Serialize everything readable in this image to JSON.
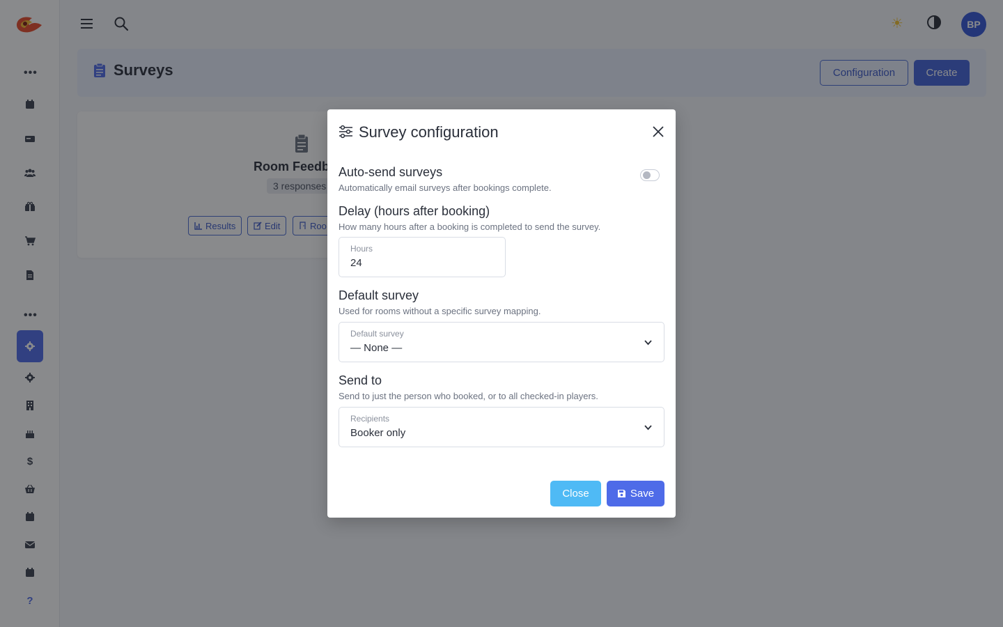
{
  "topbar": {
    "avatar_initials": "BP",
    "icons": [
      "menu-icon",
      "search-icon",
      "sun-icon",
      "contrast-icon"
    ]
  },
  "sidebar": {
    "active_color": "#4e6be8",
    "icons": [
      "dots-icon",
      "calendar-icon",
      "card-icon",
      "users-icon",
      "gift-icon",
      "cart-icon",
      "document-icon",
      "dots-icon",
      "gear-icon",
      "gear-icon",
      "building-icon",
      "cake-icon",
      "dollar-icon",
      "basket-icon",
      "calendar-icon",
      "mail-icon",
      "calendar-icon",
      "help-icon"
    ],
    "dollar_label": "$",
    "help_label": "?"
  },
  "page": {
    "title": "Surveys",
    "configuration_label": "Configuration",
    "create_label": "Create"
  },
  "survey_card": {
    "title": "Room Feedb",
    "responses": "3 responses",
    "results_label": "Results",
    "edit_label": "Edit",
    "rooms_label": "Roo"
  },
  "modal": {
    "title": "Survey configuration",
    "auto_send": {
      "title": "Auto-send surveys",
      "desc": "Automatically email surveys after bookings complete.",
      "enabled": false
    },
    "delay": {
      "title": "Delay (hours after booking)",
      "desc": "How many hours after a booking is completed to send the survey.",
      "label": "Hours",
      "value": "24"
    },
    "default_survey": {
      "title": "Default survey",
      "desc": "Used for rooms without a specific survey mapping.",
      "label": "Default survey",
      "value": "— None —"
    },
    "send_to": {
      "title": "Send to",
      "desc": "Send to just the person who booked, or to all checked-in players.",
      "label": "Recipients",
      "value": "Booker only"
    },
    "close_label": "Close",
    "save_label": "Save"
  },
  "colors": {
    "primary": "#4e6be8",
    "info": "#4fbaf5",
    "overlay": "rgba(20,22,26,0.5)"
  }
}
